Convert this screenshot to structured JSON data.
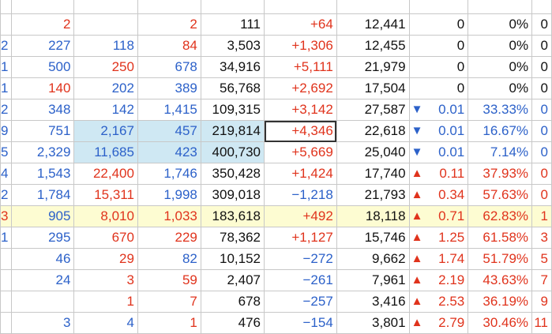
{
  "rows": [
    {
      "c": [
        "",
        "2",
        "",
        "2",
        "111",
        "+64",
        "12,441",
        null,
        "0",
        "0%",
        "0"
      ],
      "colors": [
        "blue",
        "red",
        "blue",
        "red",
        "black",
        "red",
        "black",
        null,
        "black",
        "black",
        "black"
      ],
      "bg": ""
    },
    {
      "c": [
        "2",
        "227",
        "118",
        "84",
        "3,503",
        "+1,306",
        "12,455",
        null,
        "0",
        "0%",
        "0"
      ],
      "colors": [
        "blue",
        "blue",
        "blue",
        "red",
        "black",
        "red",
        "black",
        null,
        "black",
        "black",
        "black"
      ],
      "bg": ""
    },
    {
      "c": [
        "1",
        "500",
        "250",
        "678",
        "34,916",
        "+5,111",
        "21,979",
        null,
        "0",
        "0%",
        "0"
      ],
      "colors": [
        "blue",
        "blue",
        "red",
        "blue",
        "black",
        "red",
        "black",
        null,
        "black",
        "black",
        "black"
      ],
      "bg": ""
    },
    {
      "c": [
        "1",
        "140",
        "202",
        "389",
        "56,768",
        "+2,692",
        "17,504",
        null,
        "0",
        "0%",
        "0"
      ],
      "colors": [
        "blue",
        "red",
        "blue",
        "blue",
        "black",
        "red",
        "black",
        null,
        "black",
        "black",
        "black"
      ],
      "bg": ""
    },
    {
      "c": [
        "2",
        "348",
        "142",
        "1,415",
        "109,315",
        "+3,142",
        "27,587",
        "down",
        "0.01",
        "33.33%",
        "0"
      ],
      "colors": [
        "blue",
        "blue",
        "blue",
        "blue",
        "black",
        "red",
        "black",
        "blue",
        "blue",
        "blue",
        "blue"
      ],
      "bg": ""
    },
    {
      "c": [
        "9",
        "751",
        "2,167",
        "457",
        "219,814",
        "+4,346",
        "22,618",
        "down",
        "0.01",
        "16.67%",
        "0"
      ],
      "colors": [
        "blue",
        "blue",
        "blue",
        "blue",
        "black",
        "red",
        "black",
        "blue",
        "blue",
        "blue",
        "blue"
      ],
      "bg": "blue",
      "sel": 5
    },
    {
      "c": [
        "5",
        "2,329",
        "11,685",
        "423",
        "400,730",
        "+5,669",
        "25,040",
        "down",
        "0.01",
        "7.14%",
        "0"
      ],
      "colors": [
        "blue",
        "blue",
        "blue",
        "blue",
        "black",
        "red",
        "black",
        "blue",
        "blue",
        "blue",
        "blue"
      ],
      "bg": "blue"
    },
    {
      "c": [
        "4",
        "1,543",
        "22,400",
        "1,746",
        "350,428",
        "+1,424",
        "17,740",
        "up",
        "0.11",
        "37.93%",
        "0"
      ],
      "colors": [
        "blue",
        "blue",
        "red",
        "blue",
        "black",
        "red",
        "black",
        "red",
        "red",
        "red",
        "red"
      ],
      "bg": ""
    },
    {
      "c": [
        "2",
        "1,784",
        "15,311",
        "1,998",
        "309,018",
        "−1,218",
        "21,793",
        "up",
        "0.34",
        "57.63%",
        "0"
      ],
      "colors": [
        "blue",
        "blue",
        "red",
        "blue",
        "black",
        "blue",
        "black",
        "red",
        "red",
        "red",
        "red"
      ],
      "bg": ""
    },
    {
      "c": [
        "3",
        "905",
        "8,010",
        "1,033",
        "183,618",
        "+492",
        "18,118",
        "up",
        "0.71",
        "62.83%",
        "1"
      ],
      "colors": [
        "red",
        "blue",
        "red",
        "red",
        "black",
        "red",
        "black",
        "red",
        "red",
        "red",
        "red"
      ],
      "bg": "yellow"
    },
    {
      "c": [
        "1",
        "295",
        "670",
        "229",
        "78,362",
        "+1,127",
        "15,746",
        "up",
        "1.25",
        "61.58%",
        "3"
      ],
      "colors": [
        "blue",
        "blue",
        "red",
        "red",
        "black",
        "red",
        "black",
        "red",
        "red",
        "red",
        "red"
      ],
      "bg": ""
    },
    {
      "c": [
        "",
        "46",
        "29",
        "82",
        "10,152",
        "−272",
        "9,662",
        "up",
        "1.74",
        "51.79%",
        "5"
      ],
      "colors": [
        "blue",
        "blue",
        "red",
        "blue",
        "black",
        "blue",
        "black",
        "red",
        "red",
        "red",
        "red"
      ],
      "bg": ""
    },
    {
      "c": [
        "",
        "24",
        "3",
        "59",
        "2,407",
        "−261",
        "7,961",
        "up",
        "2.19",
        "43.63%",
        "7"
      ],
      "colors": [
        "blue",
        "blue",
        "red",
        "red",
        "black",
        "blue",
        "black",
        "red",
        "red",
        "red",
        "red"
      ],
      "bg": ""
    },
    {
      "c": [
        "",
        "",
        "1",
        "7",
        "678",
        "−257",
        "3,416",
        "up",
        "2.53",
        "36.19%",
        "9"
      ],
      "colors": [
        "blue",
        "blue",
        "red",
        "red",
        "black",
        "blue",
        "black",
        "red",
        "red",
        "red",
        "red"
      ],
      "bg": ""
    },
    {
      "c": [
        "",
        "3",
        "4",
        "1",
        "476",
        "−154",
        "3,801",
        "up",
        "2.79",
        "30.46%",
        "11"
      ],
      "colors": [
        "blue",
        "blue",
        "blue",
        "red",
        "black",
        "blue",
        "black",
        "red",
        "red",
        "red",
        "red"
      ],
      "bg": ""
    }
  ],
  "icons": {
    "up": "▲",
    "down": "▼"
  }
}
